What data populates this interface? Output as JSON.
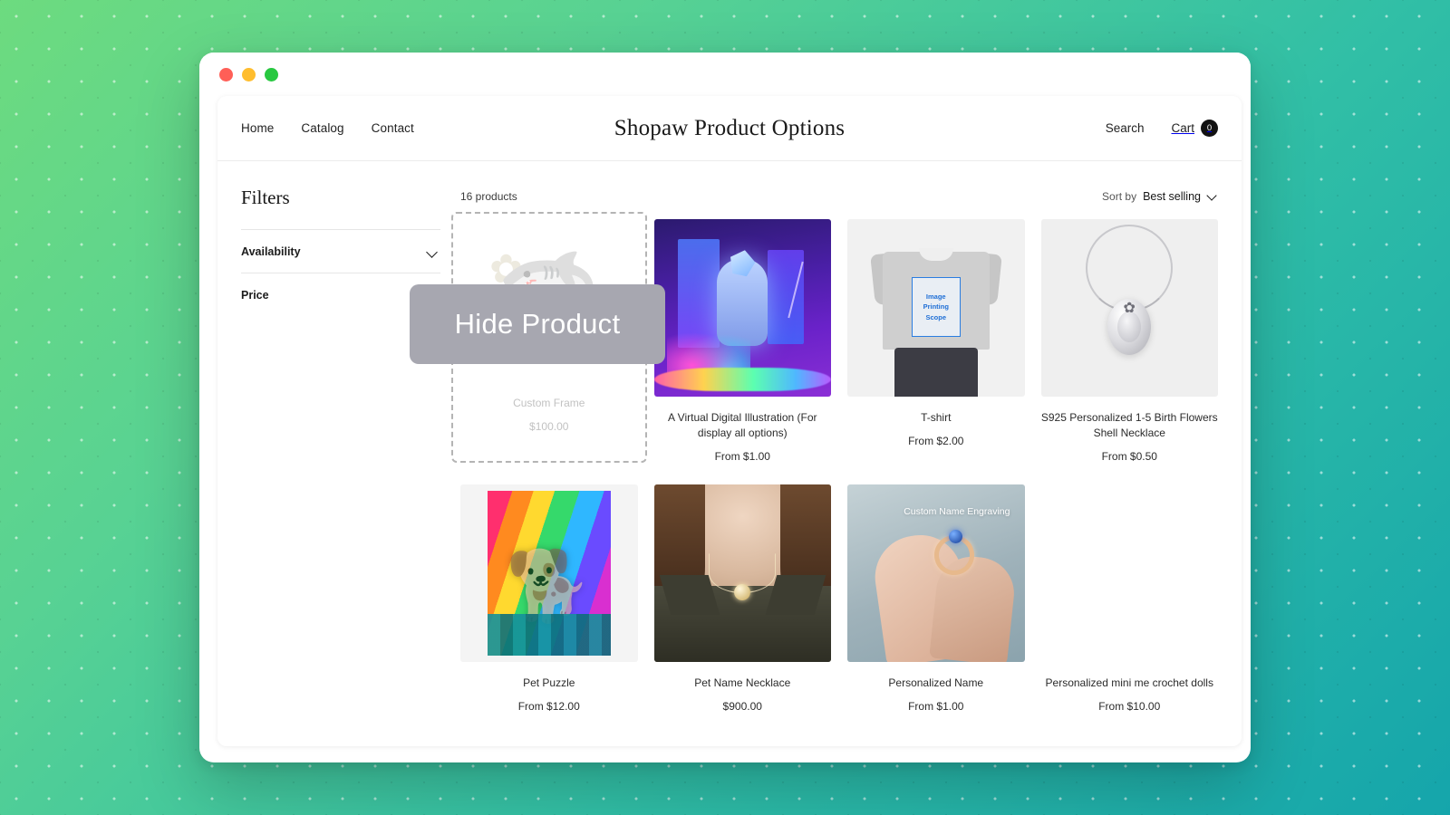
{
  "window": {
    "traffic_lights": [
      "close",
      "minimize",
      "maximize"
    ],
    "colors": {
      "close": "#ff5f57",
      "minimize": "#ffbd2e",
      "maximize": "#28c840"
    }
  },
  "header": {
    "nav": [
      {
        "label": "Home"
      },
      {
        "label": "Catalog"
      },
      {
        "label": "Contact"
      }
    ],
    "title": "Shopaw Product Options",
    "search_label": "Search",
    "cart_label": "Cart",
    "cart_count": "0"
  },
  "sidebar": {
    "title": "Filters",
    "groups": [
      {
        "label": "Availability",
        "expandable": true
      },
      {
        "label": "Price",
        "expandable": false
      }
    ]
  },
  "toolbar": {
    "product_count": "16 products",
    "sort_label": "Sort by",
    "sort_value": "Best selling"
  },
  "overlay": {
    "hide_product_label": "Hide Product",
    "background_color": "#a7a7b0",
    "text_color": "#ffffff"
  },
  "products": [
    {
      "title": "Custom Frame",
      "price": "$100.00",
      "hidden": true
    },
    {
      "title": "A Virtual Digital Illustration (For display all options)",
      "price": "From $1.00",
      "hidden": false
    },
    {
      "title": "T-shirt",
      "price": "From $2.00",
      "hidden": false,
      "image_label": "Image Printing Scope"
    },
    {
      "title": "S925 Personalized 1-5 Birth Flowers Shell Necklace",
      "price": "From $0.50",
      "hidden": false
    },
    {
      "title": "Pet Puzzle",
      "price": "From $12.00",
      "hidden": false
    },
    {
      "title": "Pet Name Necklace",
      "price": "$900.00",
      "hidden": false
    },
    {
      "title": "Personalized Name",
      "price": "From $1.00",
      "hidden": false,
      "image_label": "Custom Name Engraving"
    },
    {
      "title": "Personalized mini me crochet dolls",
      "price": "From $10.00",
      "hidden": false
    }
  ]
}
